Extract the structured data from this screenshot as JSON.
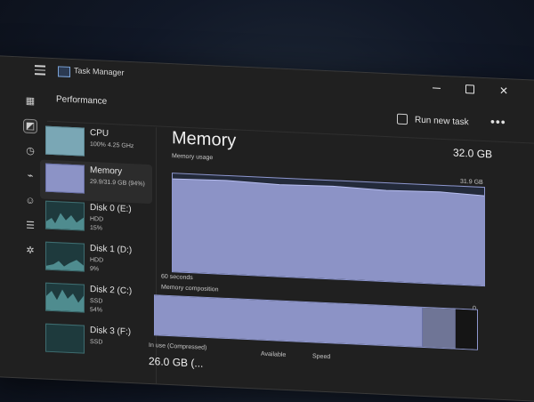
{
  "app": {
    "title": "Task Manager"
  },
  "header": {
    "section": "Performance",
    "run_new_task": "Run new task",
    "more": "•••"
  },
  "sidebar": {
    "items": [
      {
        "name": "CPU",
        "detail": "100% 4.25 GHz"
      },
      {
        "name": "Memory",
        "detail": "29.9/31.9 GB (94%)"
      },
      {
        "name": "Disk 0 (E:)",
        "detail": "HDD",
        "detail2": "15%"
      },
      {
        "name": "Disk 1 (D:)",
        "detail": "HDD",
        "detail2": "9%"
      },
      {
        "name": "Disk 2 (C:)",
        "detail": "SSD",
        "detail2": "54%"
      },
      {
        "name": "Disk 3 (F:)",
        "detail": "SSD"
      }
    ]
  },
  "main": {
    "title": "Memory",
    "total": "32.0 GB",
    "usage_label": "Memory usage",
    "usage_max": "31.9 GB",
    "time_span": "60 seconds",
    "zero": "0",
    "composition_label": "Memory composition",
    "in_use_label": "In use (Compressed)",
    "in_use_value": "26.0 GB (...",
    "available_label": "Available",
    "speed_label": "Speed"
  },
  "colors": {
    "memory_fill": "#8c93c6",
    "memory_border": "#8e97cf",
    "cpu_fill": "#7aa7b5",
    "disk_fill": "#3f6d70"
  },
  "icons": [
    "hamburger-icon",
    "task-manager-icon",
    "processes-icon",
    "performance-icon",
    "app-history-icon",
    "startup-icon",
    "users-icon",
    "details-icon",
    "services-icon",
    "run-task-icon",
    "more-icon"
  ]
}
